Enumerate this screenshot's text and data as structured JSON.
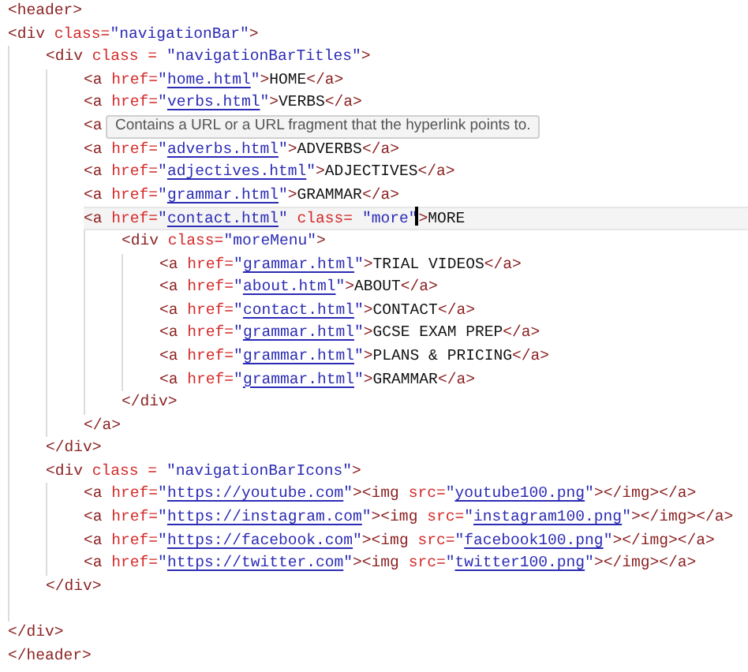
{
  "editor": {
    "lines": [
      {
        "kind": "code",
        "tokens": [
          {
            "kind": "tag",
            "text": "<header>"
          }
        ]
      },
      {
        "kind": "code",
        "tokens": [
          {
            "kind": "tag",
            "text": "<div"
          },
          {
            "kind": "attr",
            "text": " class="
          },
          {
            "kind": "str",
            "text": "\"navigationBar\""
          },
          {
            "kind": "tag",
            "text": ">"
          }
        ],
        "children": [
          {
            "kind": "code",
            "tokens": [
              {
                "kind": "tag",
                "text": "<div"
              },
              {
                "kind": "attr",
                "text": " class = "
              },
              {
                "kind": "str",
                "text": "\"navigationBarTitles\""
              },
              {
                "kind": "tag",
                "text": ">"
              }
            ],
            "children": [
              {
                "kind": "code",
                "tokens": [
                  {
                    "kind": "tag",
                    "text": "<a"
                  },
                  {
                    "kind": "attr",
                    "text": " href="
                  },
                  {
                    "kind": "str",
                    "text": "\""
                  },
                  {
                    "kind": "link",
                    "text": "home.html"
                  },
                  {
                    "kind": "str",
                    "text": "\""
                  },
                  {
                    "kind": "tag",
                    "text": ">"
                  },
                  {
                    "kind": "text",
                    "text": "HOME"
                  },
                  {
                    "kind": "tag",
                    "text": "</a>"
                  }
                ]
              },
              {
                "kind": "code",
                "tokens": [
                  {
                    "kind": "tag",
                    "text": "<a"
                  },
                  {
                    "kind": "attr",
                    "text": " href="
                  },
                  {
                    "kind": "str",
                    "text": "\""
                  },
                  {
                    "kind": "link",
                    "text": "verbs.html"
                  },
                  {
                    "kind": "str",
                    "text": "\""
                  },
                  {
                    "kind": "tag",
                    "text": ">"
                  },
                  {
                    "kind": "text",
                    "text": "VERBS"
                  },
                  {
                    "kind": "tag",
                    "text": "</a>"
                  }
                ]
              },
              {
                "kind": "code",
                "tokens": [
                  {
                    "kind": "tag",
                    "text": "<a"
                  }
                ],
                "tooltip": {
                  "text": "Contains a URL or a URL fragment that the hyperlink points to."
                }
              },
              {
                "kind": "code",
                "tokens": [
                  {
                    "kind": "tag",
                    "text": "<a"
                  },
                  {
                    "kind": "attr",
                    "text": " href="
                  },
                  {
                    "kind": "str",
                    "text": "\""
                  },
                  {
                    "kind": "link",
                    "text": "adverbs.html"
                  },
                  {
                    "kind": "str",
                    "text": "\""
                  },
                  {
                    "kind": "tag",
                    "text": ">"
                  },
                  {
                    "kind": "text",
                    "text": "ADVERBS"
                  },
                  {
                    "kind": "tag",
                    "text": "</a>"
                  }
                ]
              },
              {
                "kind": "code",
                "tokens": [
                  {
                    "kind": "tag",
                    "text": "<a"
                  },
                  {
                    "kind": "attr",
                    "text": " href="
                  },
                  {
                    "kind": "str",
                    "text": "\""
                  },
                  {
                    "kind": "link",
                    "text": "adjectives.html"
                  },
                  {
                    "kind": "str",
                    "text": "\""
                  },
                  {
                    "kind": "tag",
                    "text": ">"
                  },
                  {
                    "kind": "text",
                    "text": "ADJECTIVES"
                  },
                  {
                    "kind": "tag",
                    "text": "</a>"
                  }
                ]
              },
              {
                "kind": "code",
                "tokens": [
                  {
                    "kind": "tag",
                    "text": "<a"
                  },
                  {
                    "kind": "attr",
                    "text": " href="
                  },
                  {
                    "kind": "str",
                    "text": "\""
                  },
                  {
                    "kind": "link",
                    "text": "grammar.html"
                  },
                  {
                    "kind": "str",
                    "text": "\""
                  },
                  {
                    "kind": "tag",
                    "text": ">"
                  },
                  {
                    "kind": "text",
                    "text": "GRAMMAR"
                  },
                  {
                    "kind": "tag",
                    "text": "</a>"
                  }
                ]
              },
              {
                "kind": "code",
                "current": true,
                "tokens": [
                  {
                    "kind": "tag",
                    "text": "<a"
                  },
                  {
                    "kind": "attr",
                    "text": " href="
                  },
                  {
                    "kind": "str",
                    "text": "\""
                  },
                  {
                    "kind": "link",
                    "text": "contact.html"
                  },
                  {
                    "kind": "str",
                    "text": "\""
                  },
                  {
                    "kind": "attr",
                    "text": " class= "
                  },
                  {
                    "kind": "str",
                    "text": "\"more\""
                  },
                  {
                    "kind": "cursor"
                  },
                  {
                    "kind": "tag",
                    "text": ">"
                  },
                  {
                    "kind": "text",
                    "text": "MORE"
                  }
                ],
                "children": [
                  {
                    "kind": "code",
                    "tokens": [
                      {
                        "kind": "tag",
                        "text": "<div"
                      },
                      {
                        "kind": "attr",
                        "text": " class="
                      },
                      {
                        "kind": "str",
                        "text": "\"moreMenu\""
                      },
                      {
                        "kind": "tag",
                        "text": ">"
                      }
                    ],
                    "children": [
                      {
                        "kind": "code",
                        "tokens": [
                          {
                            "kind": "tag",
                            "text": "<a"
                          },
                          {
                            "kind": "attr",
                            "text": " href="
                          },
                          {
                            "kind": "str",
                            "text": "\""
                          },
                          {
                            "kind": "link",
                            "text": "grammar.html"
                          },
                          {
                            "kind": "str",
                            "text": "\""
                          },
                          {
                            "kind": "tag",
                            "text": ">"
                          },
                          {
                            "kind": "text",
                            "text": "TRIAL VIDEOS"
                          },
                          {
                            "kind": "tag",
                            "text": "</a>"
                          }
                        ]
                      },
                      {
                        "kind": "code",
                        "tokens": [
                          {
                            "kind": "tag",
                            "text": "<a"
                          },
                          {
                            "kind": "attr",
                            "text": " href="
                          },
                          {
                            "kind": "str",
                            "text": "\""
                          },
                          {
                            "kind": "link",
                            "text": "about.html"
                          },
                          {
                            "kind": "str",
                            "text": "\""
                          },
                          {
                            "kind": "tag",
                            "text": ">"
                          },
                          {
                            "kind": "text",
                            "text": "ABOUT"
                          },
                          {
                            "kind": "tag",
                            "text": "</a>"
                          }
                        ]
                      },
                      {
                        "kind": "code",
                        "tokens": [
                          {
                            "kind": "tag",
                            "text": "<a"
                          },
                          {
                            "kind": "attr",
                            "text": " href="
                          },
                          {
                            "kind": "str",
                            "text": "\""
                          },
                          {
                            "kind": "link",
                            "text": "contact.html"
                          },
                          {
                            "kind": "str",
                            "text": "\""
                          },
                          {
                            "kind": "tag",
                            "text": ">"
                          },
                          {
                            "kind": "text",
                            "text": "CONTACT"
                          },
                          {
                            "kind": "tag",
                            "text": "</a>"
                          }
                        ]
                      },
                      {
                        "kind": "code",
                        "tokens": [
                          {
                            "kind": "tag",
                            "text": "<a"
                          },
                          {
                            "kind": "attr",
                            "text": " href="
                          },
                          {
                            "kind": "str",
                            "text": "\""
                          },
                          {
                            "kind": "link",
                            "text": "grammar.html"
                          },
                          {
                            "kind": "str",
                            "text": "\""
                          },
                          {
                            "kind": "tag",
                            "text": ">"
                          },
                          {
                            "kind": "text",
                            "text": "GCSE EXAM PREP"
                          },
                          {
                            "kind": "tag",
                            "text": "</a>"
                          }
                        ]
                      },
                      {
                        "kind": "code",
                        "tokens": [
                          {
                            "kind": "tag",
                            "text": "<a"
                          },
                          {
                            "kind": "attr",
                            "text": " href="
                          },
                          {
                            "kind": "str",
                            "text": "\""
                          },
                          {
                            "kind": "link",
                            "text": "grammar.html"
                          },
                          {
                            "kind": "str",
                            "text": "\""
                          },
                          {
                            "kind": "tag",
                            "text": ">"
                          },
                          {
                            "kind": "text",
                            "text": "PLANS & PRICING"
                          },
                          {
                            "kind": "tag",
                            "text": "</a>"
                          }
                        ]
                      },
                      {
                        "kind": "code",
                        "tokens": [
                          {
                            "kind": "tag",
                            "text": "<a"
                          },
                          {
                            "kind": "attr",
                            "text": " href="
                          },
                          {
                            "kind": "str",
                            "text": "\""
                          },
                          {
                            "kind": "link",
                            "text": "grammar.html"
                          },
                          {
                            "kind": "str",
                            "text": "\""
                          },
                          {
                            "kind": "tag",
                            "text": ">"
                          },
                          {
                            "kind": "text",
                            "text": "GRAMMAR"
                          },
                          {
                            "kind": "tag",
                            "text": "</a>"
                          }
                        ]
                      }
                    ]
                  },
                  {
                    "kind": "code",
                    "tokens": [
                      {
                        "kind": "tag",
                        "text": "</div>"
                      }
                    ]
                  }
                ]
              },
              {
                "kind": "code",
                "tokens": [
                  {
                    "kind": "tag",
                    "text": "</a>"
                  }
                ]
              }
            ]
          },
          {
            "kind": "code",
            "tokens": [
              {
                "kind": "tag",
                "text": "</div>"
              }
            ]
          },
          {
            "kind": "code",
            "tokens": [
              {
                "kind": "tag",
                "text": "<div"
              },
              {
                "kind": "attr",
                "text": " class = "
              },
              {
                "kind": "str",
                "text": "\"navigationBarIcons\""
              },
              {
                "kind": "tag",
                "text": ">"
              }
            ],
            "children": [
              {
                "kind": "code",
                "tokens": [
                  {
                    "kind": "tag",
                    "text": "<a"
                  },
                  {
                    "kind": "attr",
                    "text": " href="
                  },
                  {
                    "kind": "str",
                    "text": "\""
                  },
                  {
                    "kind": "link",
                    "text": "https://youtube.com"
                  },
                  {
                    "kind": "str",
                    "text": "\""
                  },
                  {
                    "kind": "tag",
                    "text": "><img"
                  },
                  {
                    "kind": "attr",
                    "text": " src="
                  },
                  {
                    "kind": "str",
                    "text": "\""
                  },
                  {
                    "kind": "link",
                    "text": "youtube100.png"
                  },
                  {
                    "kind": "str",
                    "text": "\""
                  },
                  {
                    "kind": "tag",
                    "text": "></img></a>"
                  }
                ]
              },
              {
                "kind": "code",
                "tokens": [
                  {
                    "kind": "tag",
                    "text": "<a"
                  },
                  {
                    "kind": "attr",
                    "text": " href="
                  },
                  {
                    "kind": "str",
                    "text": "\""
                  },
                  {
                    "kind": "link",
                    "text": "https://instagram.com"
                  },
                  {
                    "kind": "str",
                    "text": "\""
                  },
                  {
                    "kind": "tag",
                    "text": "><img"
                  },
                  {
                    "kind": "attr",
                    "text": " src="
                  },
                  {
                    "kind": "str",
                    "text": "\""
                  },
                  {
                    "kind": "link",
                    "text": "instagram100.png"
                  },
                  {
                    "kind": "str",
                    "text": "\""
                  },
                  {
                    "kind": "tag",
                    "text": "></img></a>"
                  }
                ]
              },
              {
                "kind": "code",
                "tokens": [
                  {
                    "kind": "tag",
                    "text": "<a"
                  },
                  {
                    "kind": "attr",
                    "text": " href="
                  },
                  {
                    "kind": "str",
                    "text": "\""
                  },
                  {
                    "kind": "link",
                    "text": "https://facebook.com"
                  },
                  {
                    "kind": "str",
                    "text": "\""
                  },
                  {
                    "kind": "tag",
                    "text": "><img"
                  },
                  {
                    "kind": "attr",
                    "text": " src="
                  },
                  {
                    "kind": "str",
                    "text": "\""
                  },
                  {
                    "kind": "link",
                    "text": "facebook100.png"
                  },
                  {
                    "kind": "str",
                    "text": "\""
                  },
                  {
                    "kind": "tag",
                    "text": "></img></a>"
                  }
                ]
              },
              {
                "kind": "code",
                "tokens": [
                  {
                    "kind": "tag",
                    "text": "<a"
                  },
                  {
                    "kind": "attr",
                    "text": " href="
                  },
                  {
                    "kind": "str",
                    "text": "\""
                  },
                  {
                    "kind": "link",
                    "text": "https://twitter.com"
                  },
                  {
                    "kind": "str",
                    "text": "\""
                  },
                  {
                    "kind": "tag",
                    "text": "><img"
                  },
                  {
                    "kind": "attr",
                    "text": " src="
                  },
                  {
                    "kind": "str",
                    "text": "\""
                  },
                  {
                    "kind": "link",
                    "text": "twitter100.png"
                  },
                  {
                    "kind": "str",
                    "text": "\""
                  },
                  {
                    "kind": "tag",
                    "text": "></img></a>"
                  }
                ]
              }
            ]
          },
          {
            "kind": "code",
            "tokens": [
              {
                "kind": "tag",
                "text": "</div>"
              }
            ]
          },
          {
            "kind": "blank"
          }
        ]
      },
      {
        "kind": "code",
        "tokens": [
          {
            "kind": "tag",
            "text": "</div>"
          }
        ]
      },
      {
        "kind": "code",
        "tokens": [
          {
            "kind": "tag",
            "text": "</header>"
          }
        ]
      }
    ]
  }
}
